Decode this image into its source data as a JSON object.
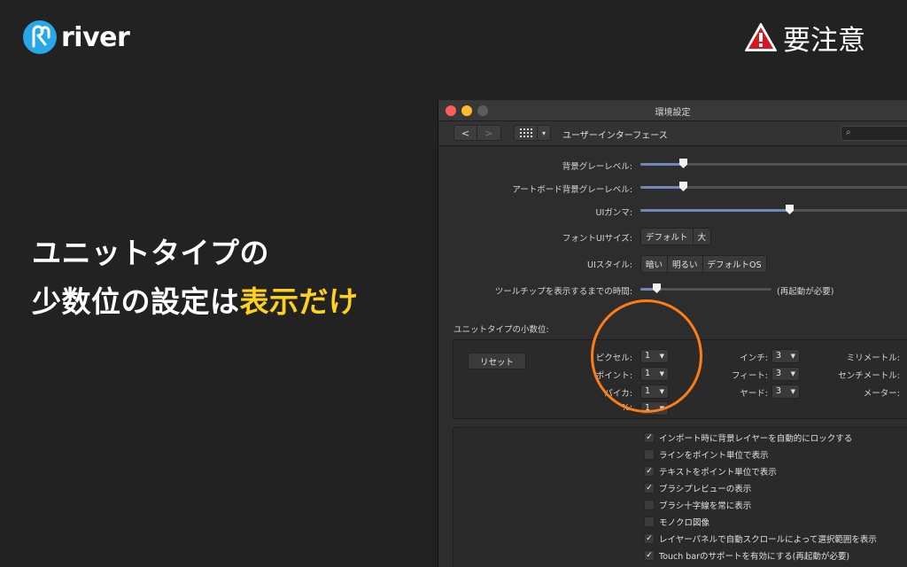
{
  "brand": {
    "name": "river",
    "logo_icon": "river-logo-icon"
  },
  "badge": {
    "icon": "warning-triangle-icon",
    "text": "要注意"
  },
  "headline": {
    "line1": "ユニットタイプの",
    "line2_prefix": "少数位の設定は",
    "line2_highlight": "表示だけ",
    "highlight_color": "#ffd21a"
  },
  "window": {
    "title": "環境設定",
    "toolbar": {
      "back": "<",
      "forward": ">",
      "grid_icon": "grid-icon",
      "grid_dropdown": "▾",
      "title": "ユーザーインターフェース",
      "search_icon": "search-icon"
    },
    "prefs": {
      "bg_gray": {
        "label": "背景グレーレベル:",
        "value_pct": 9
      },
      "artboard_gray": {
        "label": "アートボード背景グレーレベル:",
        "value_pct": 9
      },
      "ui_gamma": {
        "label": "UIガンマ:",
        "value_pct": 56
      },
      "font_size": {
        "label": "フォントUIサイズ:",
        "options": [
          "デフォルト",
          "大"
        ]
      },
      "ui_style": {
        "label": "UIスタイル:",
        "options": [
          "暗い",
          "明るい",
          "デフォルトOS"
        ]
      },
      "tooltip_delay": {
        "label": "ツールチップを表示するまでの時間:",
        "value_pct": 10,
        "note": "(再起動が必要)"
      }
    },
    "units": {
      "section_label": "ユニットタイプの小数位:",
      "reset": "リセット",
      "col1": [
        {
          "label": "ピクセル:",
          "value": "1"
        },
        {
          "label": "ポイント:",
          "value": "1"
        },
        {
          "label": "パイカ:",
          "value": "1"
        },
        {
          "label": "%:",
          "value": "1"
        }
      ],
      "col2": [
        {
          "label": "インチ:",
          "value": "3"
        },
        {
          "label": "フィート:",
          "value": "3"
        },
        {
          "label": "ヤード:",
          "value": "3"
        }
      ],
      "col3": [
        {
          "label": "ミリメートル:",
          "value": ""
        },
        {
          "label": "センチメートル:",
          "value": ""
        },
        {
          "label": "メーター:",
          "value": ""
        }
      ]
    },
    "checkboxes": [
      {
        "label": "インポート時に背景レイヤーを自動的にロックする",
        "checked": true
      },
      {
        "label": "ラインをポイント単位で表示",
        "checked": false
      },
      {
        "label": "テキストをポイント単位で表示",
        "checked": true
      },
      {
        "label": "ブラシプレビューの表示",
        "checked": true
      },
      {
        "label": "ブラシ十字線を常に表示",
        "checked": false
      },
      {
        "label": "モノクロ図像",
        "checked": false
      },
      {
        "label": "レイヤーパネルで自動スクロールによって選択範囲を表示",
        "checked": true
      },
      {
        "label": "Touch barのサポートを有効にする(再起動が必要)",
        "checked": true
      }
    ]
  }
}
